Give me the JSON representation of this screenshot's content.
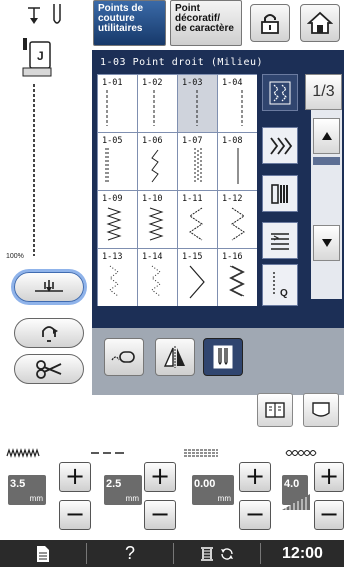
{
  "tabs": {
    "utility": [
      "Points de",
      "couture",
      "utilitaires"
    ],
    "decorative": [
      "Point",
      "décoratif/",
      "de caractère"
    ]
  },
  "panel": {
    "title": "1-03  Point droit (Milieu)",
    "stitches": [
      {
        "code": "1-01",
        "selected": false
      },
      {
        "code": "1-02",
        "selected": false
      },
      {
        "code": "1-03",
        "selected": true
      },
      {
        "code": "1-04",
        "selected": false
      },
      {
        "code": "1-05",
        "selected": false
      },
      {
        "code": "1-06",
        "selected": false
      },
      {
        "code": "1-07",
        "selected": false
      },
      {
        "code": "1-08",
        "selected": false
      },
      {
        "code": "1-09",
        "selected": false
      },
      {
        "code": "1-10",
        "selected": false
      },
      {
        "code": "1-11",
        "selected": false
      },
      {
        "code": "1-12",
        "selected": false
      },
      {
        "code": "1-13",
        "selected": false
      },
      {
        "code": "1-14",
        "selected": false
      },
      {
        "code": "1-15",
        "selected": false
      },
      {
        "code": "1-16",
        "selected": false
      }
    ],
    "page": "1/3",
    "side_q_label": "Q"
  },
  "left": {
    "tension_label": "100%"
  },
  "settings": {
    "width": {
      "value": "3.5",
      "unit": "mm"
    },
    "length": {
      "value": "2.5",
      "unit": "mm"
    },
    "needle_position": {
      "value": "0.00",
      "unit": "mm"
    },
    "tension": {
      "value": "4.0"
    }
  },
  "status": {
    "help": "?",
    "time": "12:00"
  },
  "colors": {
    "panel_bg": "#1c2f56",
    "active_tab": "#17396a",
    "highlight": "#8fb3ea"
  }
}
